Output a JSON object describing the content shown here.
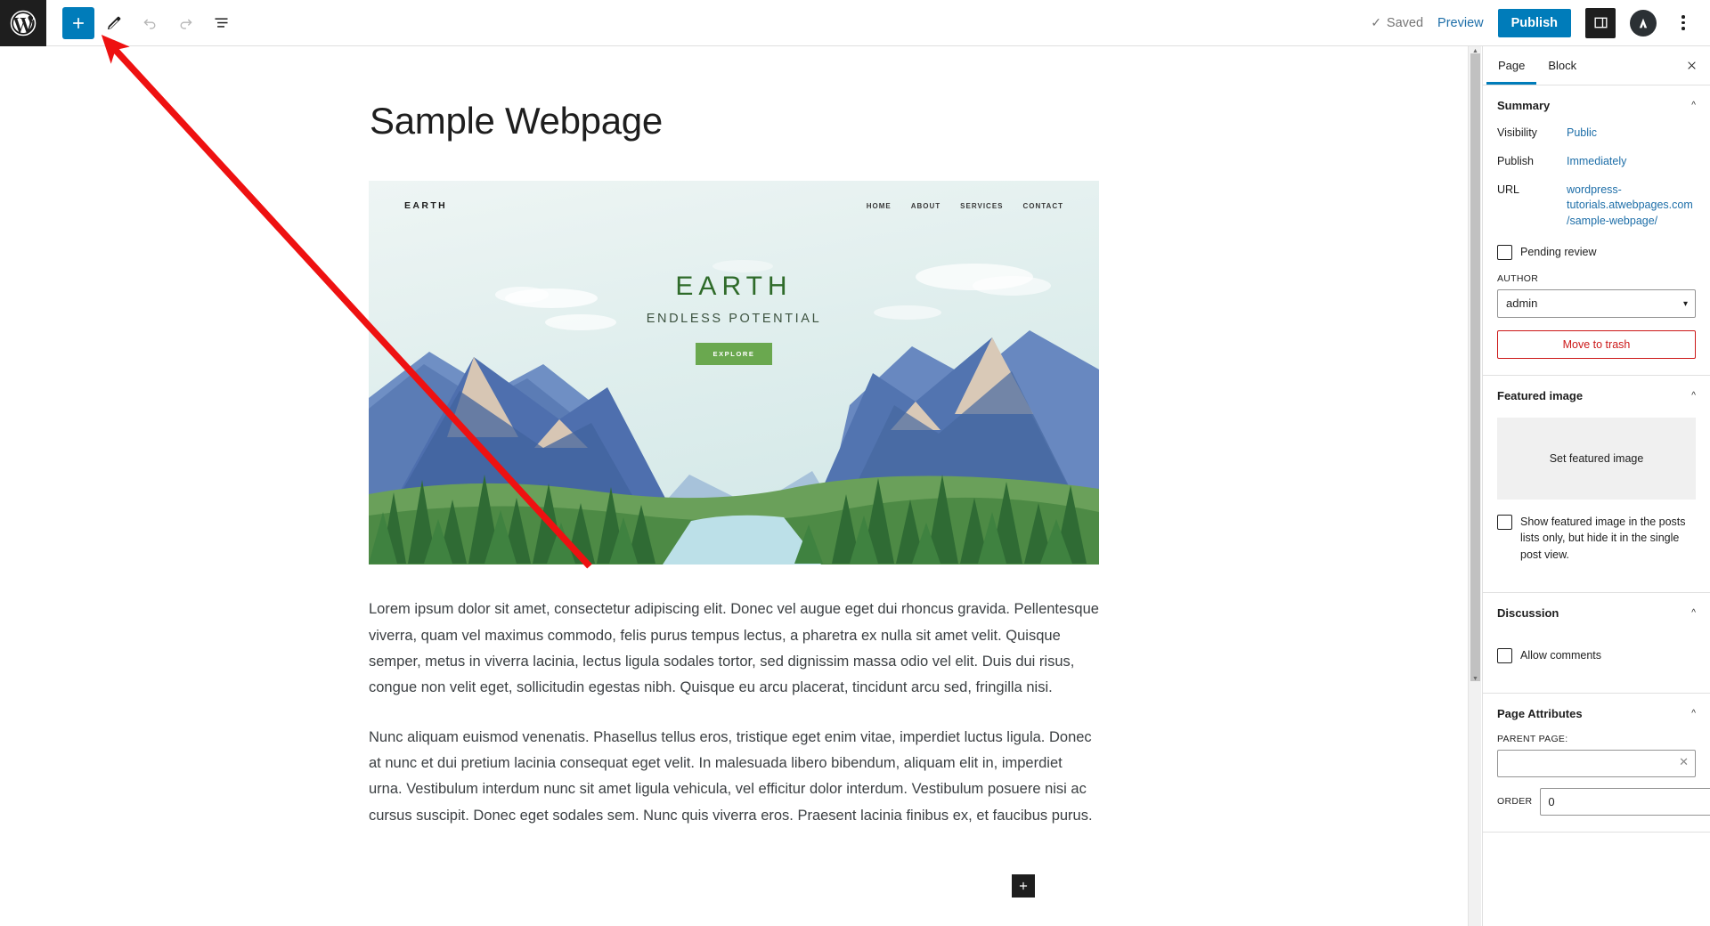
{
  "topbar": {
    "wp_logo": "wordpress-logo",
    "add_block_label": "+",
    "tools": [
      {
        "name": "add-block-button",
        "icon": "plus-icon"
      },
      {
        "name": "tools-edit-button",
        "icon": "pencil-icon"
      },
      {
        "name": "undo-button",
        "icon": "undo-arrow-icon"
      },
      {
        "name": "redo-button",
        "icon": "redo-arrow-icon"
      },
      {
        "name": "document-overview-button",
        "icon": "list-view-icon"
      }
    ],
    "saved_label": "Saved",
    "saved_check": "✓",
    "preview_label": "Preview",
    "publish_label": "Publish",
    "settings_icon": "sidebar-panel-icon",
    "avatar_icon": "astra-logo-icon",
    "kebab_icon": "more-options-icon"
  },
  "editor": {
    "page_title": "Sample Webpage",
    "paragraph_1": "Lorem ipsum dolor sit amet, consectetur adipiscing elit. Donec vel augue eget dui rhoncus gravida. Pellentesque viverra, quam vel maximus commodo, felis purus tempus lectus, a pharetra ex nulla sit amet velit. Quisque semper, metus in viverra lacinia, lectus ligula sodales tortor, sed dignissim massa odio vel elit. Duis dui risus, congue non velit eget, sollicitudin egestas nibh. Quisque eu arcu placerat, tincidunt arcu sed, fringilla nisi.",
    "paragraph_2": "Nunc aliquam euismod venenatis. Phasellus tellus eros, tristique eget enim vitae, imperdiet luctus ligula. Donec at nunc et dui pretium lacinia consequat eget velit. In malesuada libero bibendum, aliquam elit in, imperdiet urna. Vestibulum interdum nunc sit amet ligula vehicula, vel efficitur dolor interdum. Vestibulum posuere nisi ac cursus suscipit. Donec eget sodales sem. Nunc quis viverra eros. Praesent lacinia finibus ex, et faucibus purus.",
    "bottom_inserter_label": "+"
  },
  "featured_image": {
    "site_logo": "EARTH",
    "nav_items": [
      "HOME",
      "ABOUT",
      "SERVICES",
      "CONTACT"
    ],
    "hero_title": "EARTH",
    "hero_subtitle": "ENDLESS POTENTIAL",
    "hero_button": "EXPLORE"
  },
  "sidebar": {
    "tabs": [
      {
        "label": "Page",
        "active": true
      },
      {
        "label": "Block",
        "active": false
      }
    ],
    "close_icon": "close-icon",
    "summary": {
      "title": "Summary",
      "rows": [
        {
          "label": "Visibility",
          "value": "Public"
        },
        {
          "label": "Publish",
          "value": "Immediately"
        },
        {
          "label": "URL",
          "value": "wordpress-tutorials.atwebpages.com/sample-webpage/"
        }
      ],
      "pending_review_label": "Pending review",
      "author_label": "AUTHOR",
      "author_value": "admin",
      "trash_label": "Move to trash"
    },
    "featured_image": {
      "title": "Featured image",
      "set_label": "Set featured image",
      "show_in_lists_label": "Show featured image in the posts lists only, but hide it in the single post view."
    },
    "discussion": {
      "title": "Discussion",
      "allow_comments_label": "Allow comments"
    },
    "page_attributes": {
      "title": "Page Attributes",
      "parent_label": "PARENT PAGE:",
      "parent_value": "",
      "order_label": "ORDER",
      "order_value": "0"
    }
  },
  "colors": {
    "accent_blue": "#007cba",
    "link_blue": "#1d6ea8",
    "danger_red": "#cc1818",
    "annotation_red": "#ee1111",
    "dark": "#1e1e1e"
  }
}
